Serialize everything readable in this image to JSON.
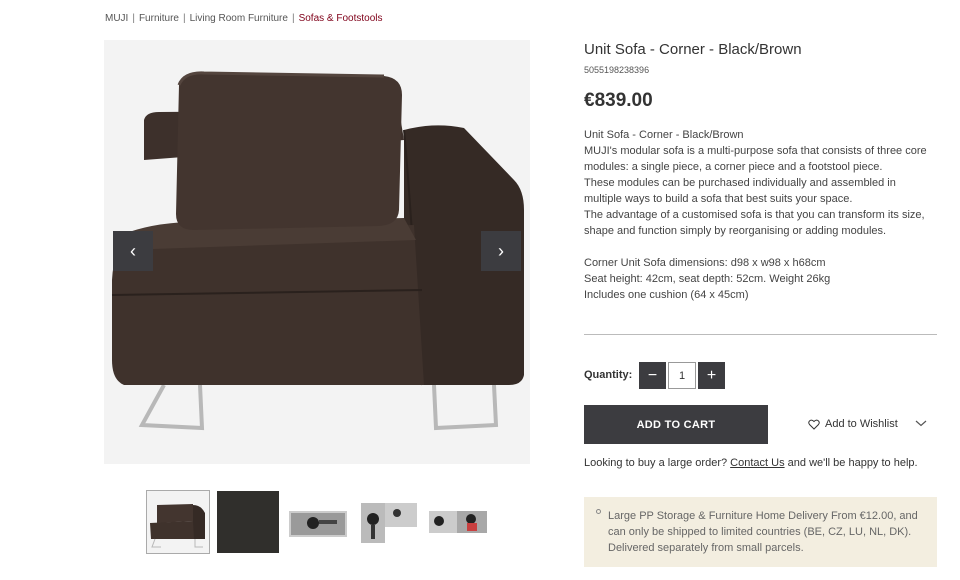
{
  "breadcrumb": {
    "items": [
      "MUJI",
      "Furniture",
      "Living Room Furniture"
    ],
    "separator": "|",
    "current": "Sofas & Footstools"
  },
  "gallery": {
    "main_image": "sofa-corner-unit-photo",
    "prev_icon": "‹",
    "next_icon": "›",
    "thumbnails": [
      "sofa-front-view",
      "fabric-swatch",
      "top-view-1",
      "top-view-2",
      "top-view-3"
    ],
    "active_thumbnail": 0
  },
  "product": {
    "title": "Unit Sofa - Corner - Black/Brown",
    "sku": "5055198238396",
    "price": "€839.00",
    "description": [
      "Unit Sofa - Corner - Black/Brown",
      "MUJI's modular sofa is a multi-purpose sofa that consists of three core modules: a single piece, a corner piece and a footstool piece.",
      "These modules can be purchased individually and assembled in multiple ways to build a sofa that best suits your space.",
      "The advantage of a customised sofa is that you can transform its size, shape and function simply by reorganising or adding modules.",
      "",
      "Corner Unit Sofa dimensions: d98 x w98 x h68cm",
      "Seat height: 42cm, seat depth: 52cm. Weight 26kg",
      "Includes one cushion (64 x 45cm)"
    ]
  },
  "purchase": {
    "quantity_label": "Quantity:",
    "quantity_value": "1",
    "minus_label": "−",
    "plus_label": "+",
    "add_to_cart_label": "ADD TO CART",
    "wishlist_label": "Add to Wishlist"
  },
  "large_order": {
    "prefix": "Looking to buy a large order?",
    "link": "Contact Us",
    "suffix": "and we'll be happy to help."
  },
  "notice": {
    "text": "Large PP Storage & Furniture Home Delivery From €12.00, and can only be shipped to limited countries (BE, CZ, LU, NL, DK). Delivered separately from small parcels."
  },
  "colors": {
    "dark_button": "#3c3c40",
    "breadcrumb_active": "#7f0019",
    "notice_bg": "#f3eee0"
  }
}
